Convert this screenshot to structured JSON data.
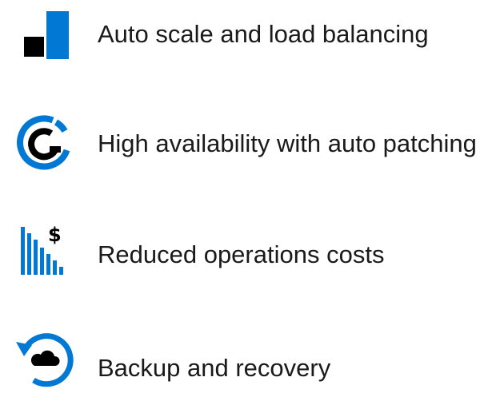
{
  "colors": {
    "accent": "#0078d4",
    "ink": "#000000",
    "text": "#1a1a1a"
  },
  "features": [
    {
      "icon": "scale-squares-icon",
      "label": "Auto scale and load balancing"
    },
    {
      "icon": "availability-ring-icon",
      "label": "High availability with auto patching"
    },
    {
      "icon": "cost-bars-dollar-icon",
      "label": "Reduced operations costs"
    },
    {
      "icon": "backup-cloud-icon",
      "label": "Backup and recovery"
    }
  ]
}
